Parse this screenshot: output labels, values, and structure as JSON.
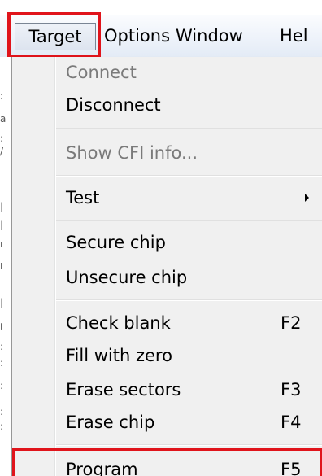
{
  "menubar": {
    "target": "Target",
    "options": "Options",
    "window": "Window",
    "help": "Hel"
  },
  "menu": {
    "connect": "Connect",
    "disconnect": "Disconnect",
    "show_cfi": "Show CFI info...",
    "test": "Test",
    "secure_chip": "Secure chip",
    "unsecure_chip": "Unsecure chip",
    "check_blank": "Check blank",
    "check_blank_key": "F2",
    "fill_zero": "Fill with zero",
    "erase_sectors": "Erase sectors",
    "erase_sectors_key": "F3",
    "erase_chip": "Erase chip",
    "erase_chip_key": "F4",
    "program": "Program",
    "program_key": "F5"
  },
  "colors": {
    "highlight": "#e0141b",
    "menu_bg": "#f0f0f0",
    "disabled_text": "#7a7a7a"
  }
}
